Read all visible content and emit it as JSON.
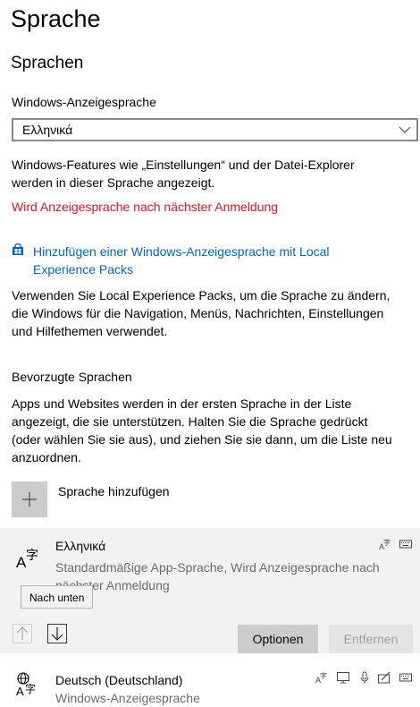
{
  "page": {
    "title": "Sprache"
  },
  "sprachen": {
    "heading": "Sprachen",
    "display_label": "Windows-Anzeigesprache",
    "display_value": "Ελληνικά",
    "display_desc_line1": "Windows-Features wie „Einstellungen“ und der Datei-Explorer",
    "display_desc_line2": "werden in dieser Sprache angezeigt.",
    "warning": "Wird Anzeigesprache nach nächster Anmeldung",
    "lxp_link_line1": "Hinzufügen einer Windows-Anzeigesprache mit Local",
    "lxp_link_line2": "Experience Packs",
    "lxp_desc_line1": "Verwenden Sie Local Experience Packs, um die Sprache zu ändern,",
    "lxp_desc_line2": "die Windows für die Navigation, Menüs, Nachrichten, Einstellungen",
    "lxp_desc_line3": "und Hilfethemen verwendet."
  },
  "preferred": {
    "heading": "Bevorzugte Sprachen",
    "desc_line1": "Apps und Websites werden in der ersten Sprache in der Liste",
    "desc_line2": "angezeigt, die sie unterstützen. Halten Sie die Sprache gedrückt",
    "desc_line3": "(oder wählen Sie sie aus), und ziehen Sie sie dann, um die Liste neu",
    "desc_line4": "anzuordnen.",
    "add_label": "Sprache hinzufügen",
    "languages": [
      {
        "name": "Ελληνικά",
        "status_line1": "Standardmäßige App-Sprache, Wird Anzeigesprache nach",
        "status_line2": "nächster Anmeldung",
        "icons": [
          "language-options-icon",
          "keyboard-icon"
        ]
      },
      {
        "name": "Deutsch (Deutschland)",
        "status_line1": "Windows-Anzeigesprache",
        "icons": [
          "language-options-icon",
          "display-language-icon",
          "speech-icon",
          "handwriting-icon",
          "keyboard-icon"
        ]
      }
    ],
    "tooltip": "Nach unten",
    "options_label": "Optionen",
    "remove_label": "Entfernen"
  }
}
